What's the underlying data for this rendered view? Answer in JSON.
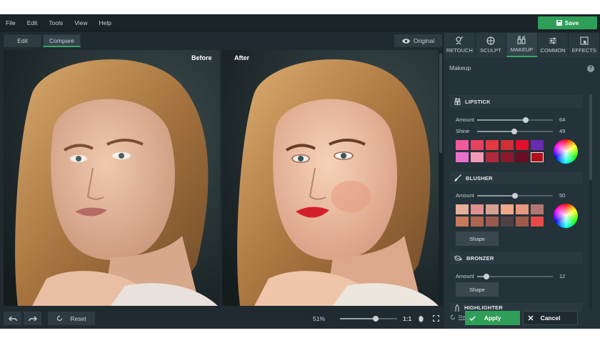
{
  "menu": [
    "File",
    "Edit",
    "Tools",
    "View",
    "Help"
  ],
  "save_label": "Save",
  "modes": {
    "edit": "Edit",
    "compare": "Compare"
  },
  "original_label": "Original",
  "before_label": "Before",
  "after_label": "After",
  "tabs": [
    {
      "label": "RETOUCH",
      "icon": "retouch-icon"
    },
    {
      "label": "SCULPT",
      "icon": "sculpt-icon"
    },
    {
      "label": "MAKEUP",
      "icon": "makeup-icon"
    },
    {
      "label": "COMMON",
      "icon": "sliders-icon"
    },
    {
      "label": "EFFECTS",
      "icon": "effects-icon"
    }
  ],
  "panel_title": "Makeup",
  "help_icon": "?",
  "lipstick": {
    "title": "LIPSTICK",
    "amount_label": "Amount",
    "amount": 64,
    "shine_label": "Shine",
    "shine": 49,
    "swatches": [
      "#f05a9c",
      "#e8405f",
      "#e23a3e",
      "#d03038",
      "#e0102a",
      "#6a2bb0",
      "#e870c8",
      "#f29ab8",
      "#b02a3c",
      "#8a1a2a",
      "#6a0d22",
      "#b00e1a"
    ],
    "selected_swatch": 11
  },
  "blusher": {
    "title": "BLUSHER",
    "amount_label": "Amount",
    "amount": 50,
    "swatches": [
      "#e8b09a",
      "#e09090",
      "#d8a090",
      "#f0a888",
      "#e89880",
      "#b07870",
      "#c8785a",
      "#b0664e",
      "#9a5a50",
      "#4e4244",
      "#a05a4a",
      "#e84848"
    ],
    "shape_label": "Shape"
  },
  "bronzer": {
    "title": "BRONZER",
    "amount_label": "Amount",
    "amount": 12,
    "shape_label": "Shape"
  },
  "highlighter": {
    "title": "HIGHLIGHTER"
  },
  "reset_all": "Reset all",
  "bottom": {
    "reset_label": "Reset",
    "zoom": "51%",
    "zoom_value": 0.63,
    "one_to_one": "1:1"
  },
  "apply_label": "Apply",
  "cancel_label": "Cancel"
}
